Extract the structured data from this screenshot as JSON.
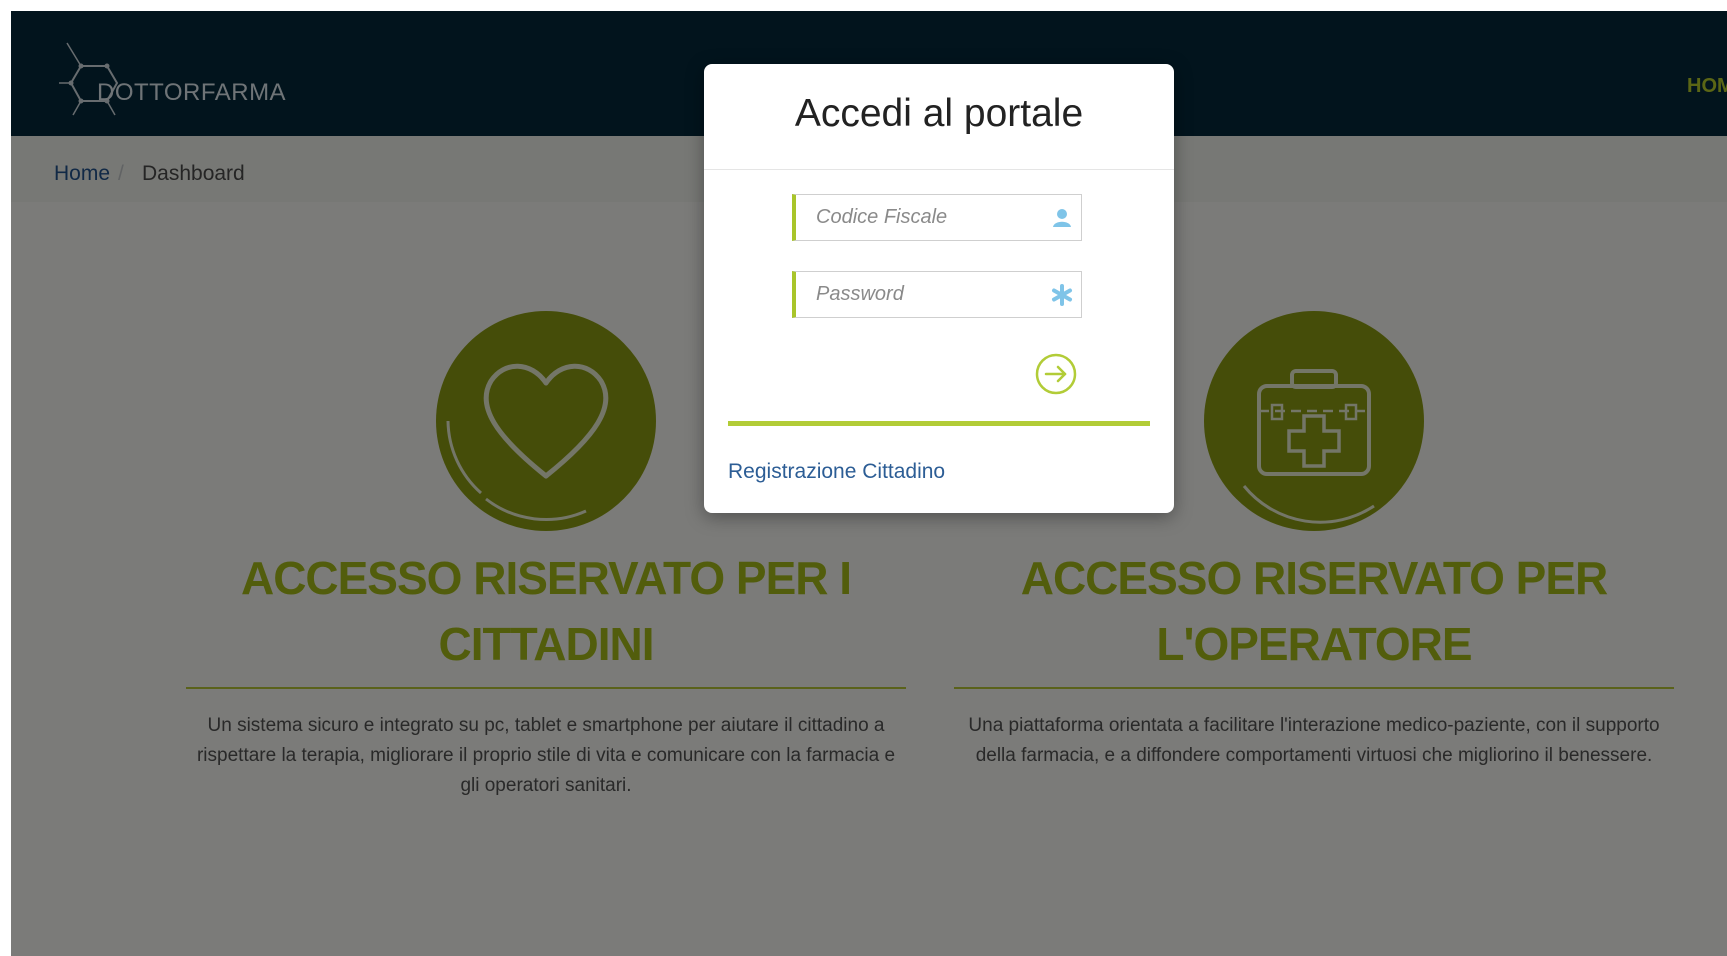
{
  "header": {
    "logo_text": "DOTTORFARMA",
    "nav_home": "HOME"
  },
  "breadcrumb": {
    "home": "Home",
    "separator": "/",
    "current": "Dashboard"
  },
  "sections": [
    {
      "icon": "heart-icon",
      "title": "ACCESSO RISERVATO PER I CITTADINI",
      "text": "Un sistema sicuro e integrato su pc, tablet e smartphone per aiutare il cittadino a rispettare la terapia, migliorare il proprio stile di vita e comunicare con la farmacia e gli operatori sanitari."
    },
    {
      "icon": "first-aid-kit-icon",
      "title": "ACCESSO RISERVATO PER L'OPERATORE",
      "text": "Una piattaforma orientata a facilitare l'interazione medico-paziente, con il supporto della farmacia, e a diffondere comportamenti virtuosi che migliorino il benessere."
    }
  ],
  "login_modal": {
    "title": "Accedi al portale",
    "codice_fiscale": {
      "placeholder": "Codice Fiscale",
      "value": "",
      "icon": "user-icon"
    },
    "password": {
      "placeholder": "Password",
      "value": "",
      "icon": "asterisk-icon"
    },
    "submit_icon": "arrow-right-circle-icon",
    "register_link": "Registrazione Cittadino"
  },
  "colors": {
    "header_bg": "#05283a",
    "accent_green": "#a4ba19",
    "link_blue": "#2c5d95"
  }
}
